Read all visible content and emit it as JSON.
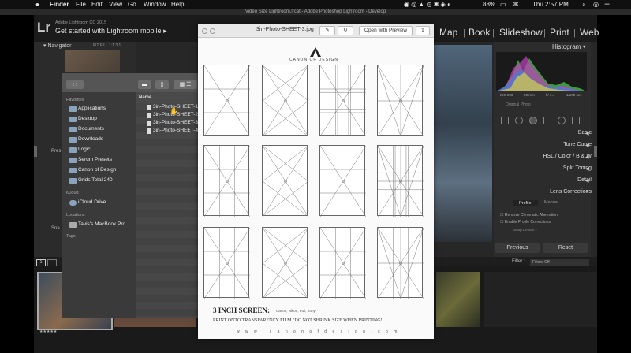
{
  "menubar": {
    "app": "Finder",
    "items": [
      "File",
      "Edit",
      "View",
      "Go",
      "Window",
      "Help"
    ],
    "doc_title": "Video Size Lightroom.lrcat - Adobe Photoshop Lightroom - Develop",
    "battery": "88%",
    "clock": "Thu 2:57 PM"
  },
  "lightroom": {
    "logo": "Lr",
    "version": "Adobe Lightroom CC 2015",
    "getstarted": "Get started with Lightroom mobile",
    "modules": [
      "Map",
      "Book",
      "Slideshow",
      "Print",
      "Web"
    ],
    "navigator": "Navigator",
    "nav_options": "FIT  FILL  1:1  3:1",
    "presets_label": "Pres",
    "snapshots_label": "Sna",
    "histogram": "Histogram",
    "exif": {
      "iso": "ISO 250",
      "focal": "50 mm",
      "aperture": "f / 1.4",
      "shutter": "1/160 sec"
    },
    "original_photo": "Original Photo",
    "panels": [
      "Basic",
      "Tone Curve",
      "HSL  /  Color  /  B & W",
      "Split Toning",
      "Detail",
      "Lens Corrections"
    ],
    "lens_tabs": [
      "Profile",
      "Manual"
    ],
    "lens_options": [
      "Remove Chromatic Aberration",
      "Enable Profile Corrections"
    ],
    "setup": "Setup    Default  ÷",
    "previous_button": "Previous",
    "reset_button": "Reset",
    "filmstrip_page": "1",
    "filter_label": "Filter :",
    "filter_value": "Filters Off",
    "stars": "★★★★★"
  },
  "finder": {
    "favorites_label": "Favorites",
    "favorites": [
      "Applications",
      "Desktop",
      "Documents",
      "Downloads",
      "Logic",
      "Serum Presets",
      "Canon of Design",
      "Grids Total 240"
    ],
    "icloud_label": "iCloud",
    "icloud": [
      "iCloud Drive"
    ],
    "locations_label": "Locations",
    "locations": [
      "Tavis's MacBook Pro"
    ],
    "tags_label": "Tags",
    "column_name": "Name",
    "files": [
      "3in-Photo-SHEET-1",
      "3in-Photo-SHEET-2",
      "3in-Photo-SHEET-3",
      "3in-Photo-SHEET-4"
    ]
  },
  "preview": {
    "title": "3in-Photo-SHEET-3.jpg",
    "open_button": "Open with Preview",
    "logo_text": "CANON OF DESIGN",
    "heading": "3 INCH SCREEN:",
    "heading_sub": "Canon, Nikon, Fuji, Sony",
    "note": "PRINT ONTO TRANSPARENCY FILM \"DO NOT SHRINK SIZE WHEN PRINTING!",
    "url": "w w w . c a n o n o f d e s i g n . c o m"
  }
}
